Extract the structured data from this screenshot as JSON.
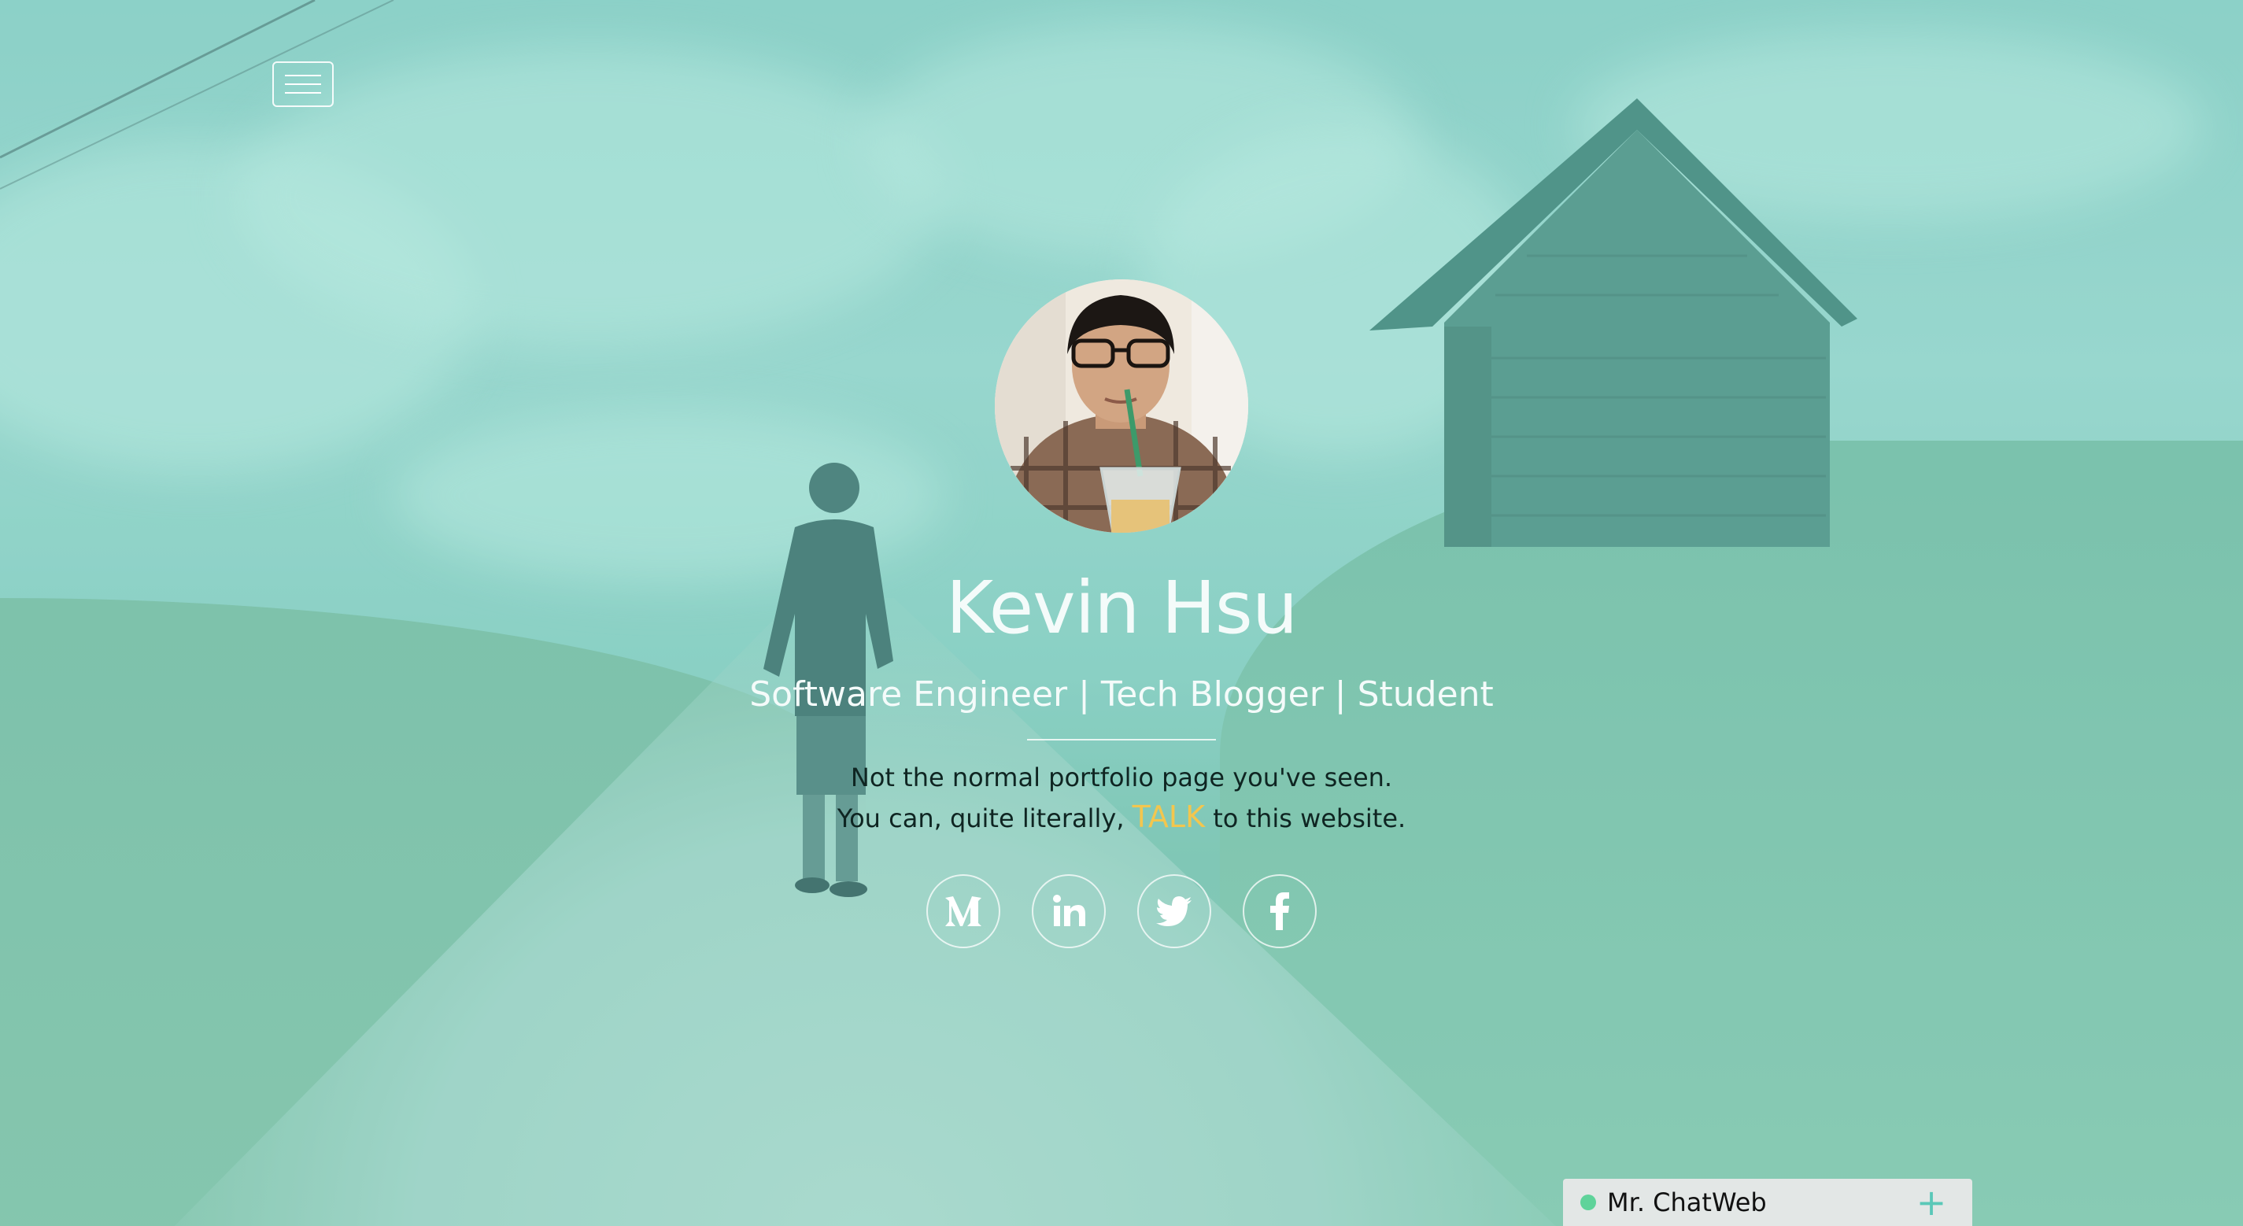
{
  "menu": {
    "icon": "hamburger-menu-icon"
  },
  "profile": {
    "name": "Kevin Hsu",
    "roles": "Software Engineer | Tech Blogger | Student",
    "tagline_line1": "Not the normal portfolio page you've seen.",
    "tagline_line2_before": "You can, quite literally,",
    "tagline_highlight": "TALK",
    "tagline_line2_after": "to this website.",
    "highlight_color": "#f3c64e"
  },
  "socials": [
    {
      "name": "medium",
      "icon": "medium-icon"
    },
    {
      "name": "linkedin",
      "icon": "linkedin-icon"
    },
    {
      "name": "twitter",
      "icon": "twitter-icon"
    },
    {
      "name": "facebook",
      "icon": "facebook-icon"
    }
  ],
  "chat": {
    "title": "Mr. ChatWeb",
    "status_color": "#5fd39a",
    "expand_icon": "plus-icon"
  },
  "theme": {
    "overlay": "#82d2c8",
    "text_light": "#f4fbfa",
    "text_dark": "#0f2522"
  }
}
